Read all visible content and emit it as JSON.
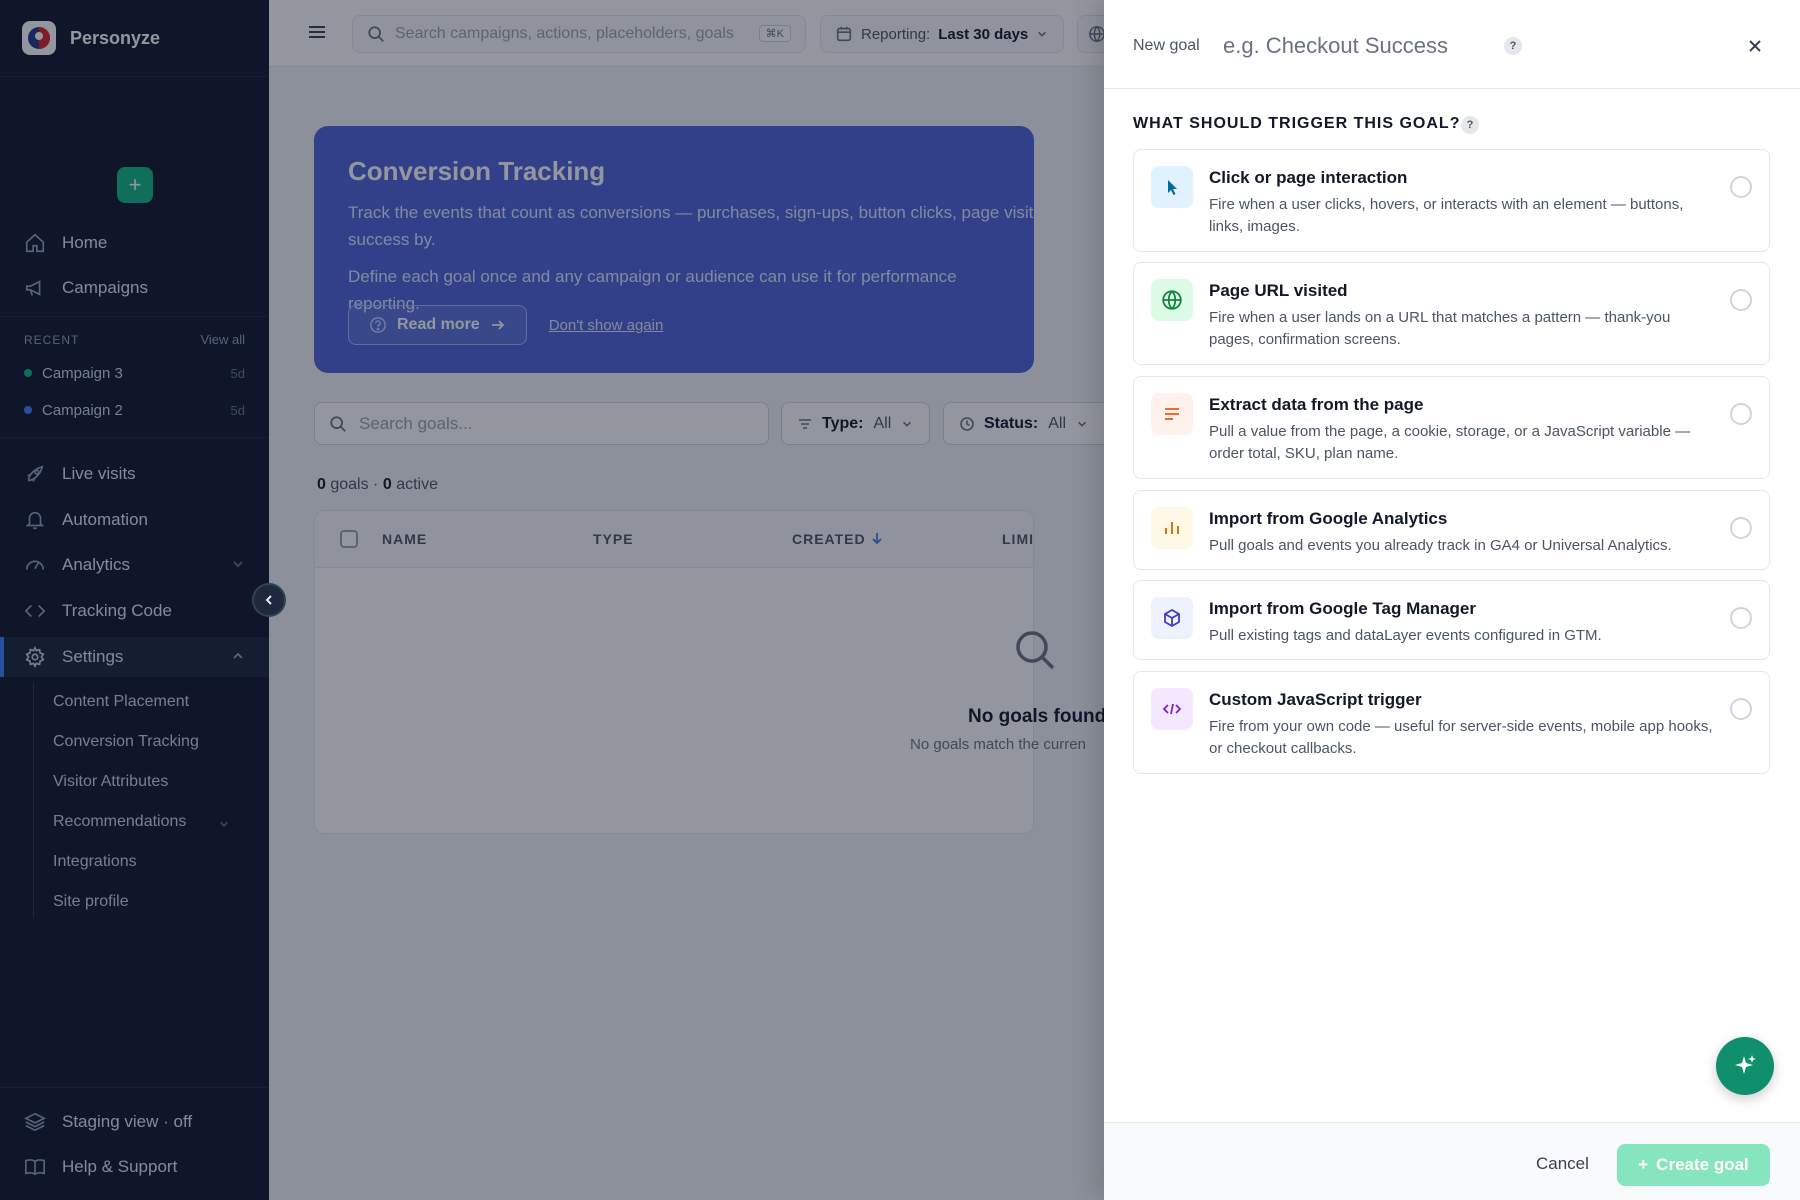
{
  "brand": {
    "name": "Personyze"
  },
  "sidebar": {
    "nav": [
      {
        "label": "Home"
      },
      {
        "label": "Campaigns"
      },
      {
        "label": "Live visits"
      },
      {
        "label": "Automation"
      },
      {
        "label": "Analytics"
      },
      {
        "label": "Tracking Code"
      },
      {
        "label": "Settings"
      }
    ],
    "recent_label": "RECENT",
    "view_all": "View all",
    "recent": [
      {
        "name": "Campaign 3",
        "age": "5d",
        "color": "#10b981"
      },
      {
        "name": "Campaign 2",
        "age": "5d",
        "color": "#3b82f6"
      }
    ],
    "settings_sub": [
      {
        "label": "Content Placement"
      },
      {
        "label": "Conversion Tracking"
      },
      {
        "label": "Visitor Attributes"
      },
      {
        "label": "Recommendations"
      },
      {
        "label": "Integrations"
      },
      {
        "label": "Site profile"
      }
    ],
    "bottom": [
      {
        "label": "Staging view · off"
      },
      {
        "label": "Help & Support"
      }
    ]
  },
  "topbar": {
    "search_placeholder": "Search campaigns, actions, placeholders, goals",
    "search_shortcut": "⌘K",
    "reporting_label": "Reporting:",
    "reporting_value": "Last 30 days"
  },
  "banner": {
    "title": "Conversion Tracking",
    "text": "Track the events that count as conversions — purchases, sign-ups, button clicks, page visits, anything you measure success by.",
    "text_line1": "Track the events that count as conversions — purchases, sign-ups, button clicks, page visits, anyt",
    "text_line2": "success by.",
    "text2": "Define each goal once and any campaign or audience can use it for performance reporting.",
    "read_more": "Read more",
    "dont_show": "Don't show again"
  },
  "goals": {
    "search_placeholder": "Search goals...",
    "type_label": "Type:",
    "type_value": "All",
    "status_label": "Status:",
    "status_value": "All",
    "count": "0",
    "count_label": "goals ·",
    "active": "0",
    "active_label": "active",
    "columns": [
      "NAME",
      "TYPE",
      "CREATED",
      "LIMIT"
    ],
    "empty_title": "No goals found",
    "empty_sub": "No goals match the curren"
  },
  "drawer": {
    "new_goal_label": "New goal",
    "name_placeholder": "e.g. Checkout Success",
    "help": "?",
    "section_title": "WHAT SHOULD TRIGGER THIS GOAL?",
    "options": [
      {
        "title": "Click or page interaction",
        "desc": "Fire when a user clicks, hovers, or interacts with an element — buttons, links, images.",
        "icon": "cursor-click-icon"
      },
      {
        "title": "Page URL visited",
        "desc": "Fire when a user lands on a URL that matches a pattern — thank-you pages, confirmation screens.",
        "icon": "globe-icon"
      },
      {
        "title": "Extract data from the page",
        "desc": "Pull a value from the page, a cookie, storage, or a JavaScript variable — order total, SKU, plan name.",
        "icon": "text-lines-icon"
      },
      {
        "title": "Import from Google Analytics",
        "desc": "Pull goals and events you already track in GA4 or Universal Analytics.",
        "icon": "bar-chart-icon"
      },
      {
        "title": "Import from Google Tag Manager",
        "desc": "Pull existing tags and dataLayer events configured in GTM.",
        "icon": "cube-icon"
      },
      {
        "title": "Custom JavaScript trigger",
        "desc": "Fire from your own code — useful for server-side events, mobile app hooks, or checkout callbacks.",
        "icon": "code-icon"
      }
    ],
    "cancel": "Cancel",
    "create": "Create goal"
  },
  "colors": {
    "sidebar_bg": "#0f172a",
    "accent_green": "#10b981",
    "banner_blue": "#4f63d8",
    "create_disabled": "#86e4bf"
  }
}
